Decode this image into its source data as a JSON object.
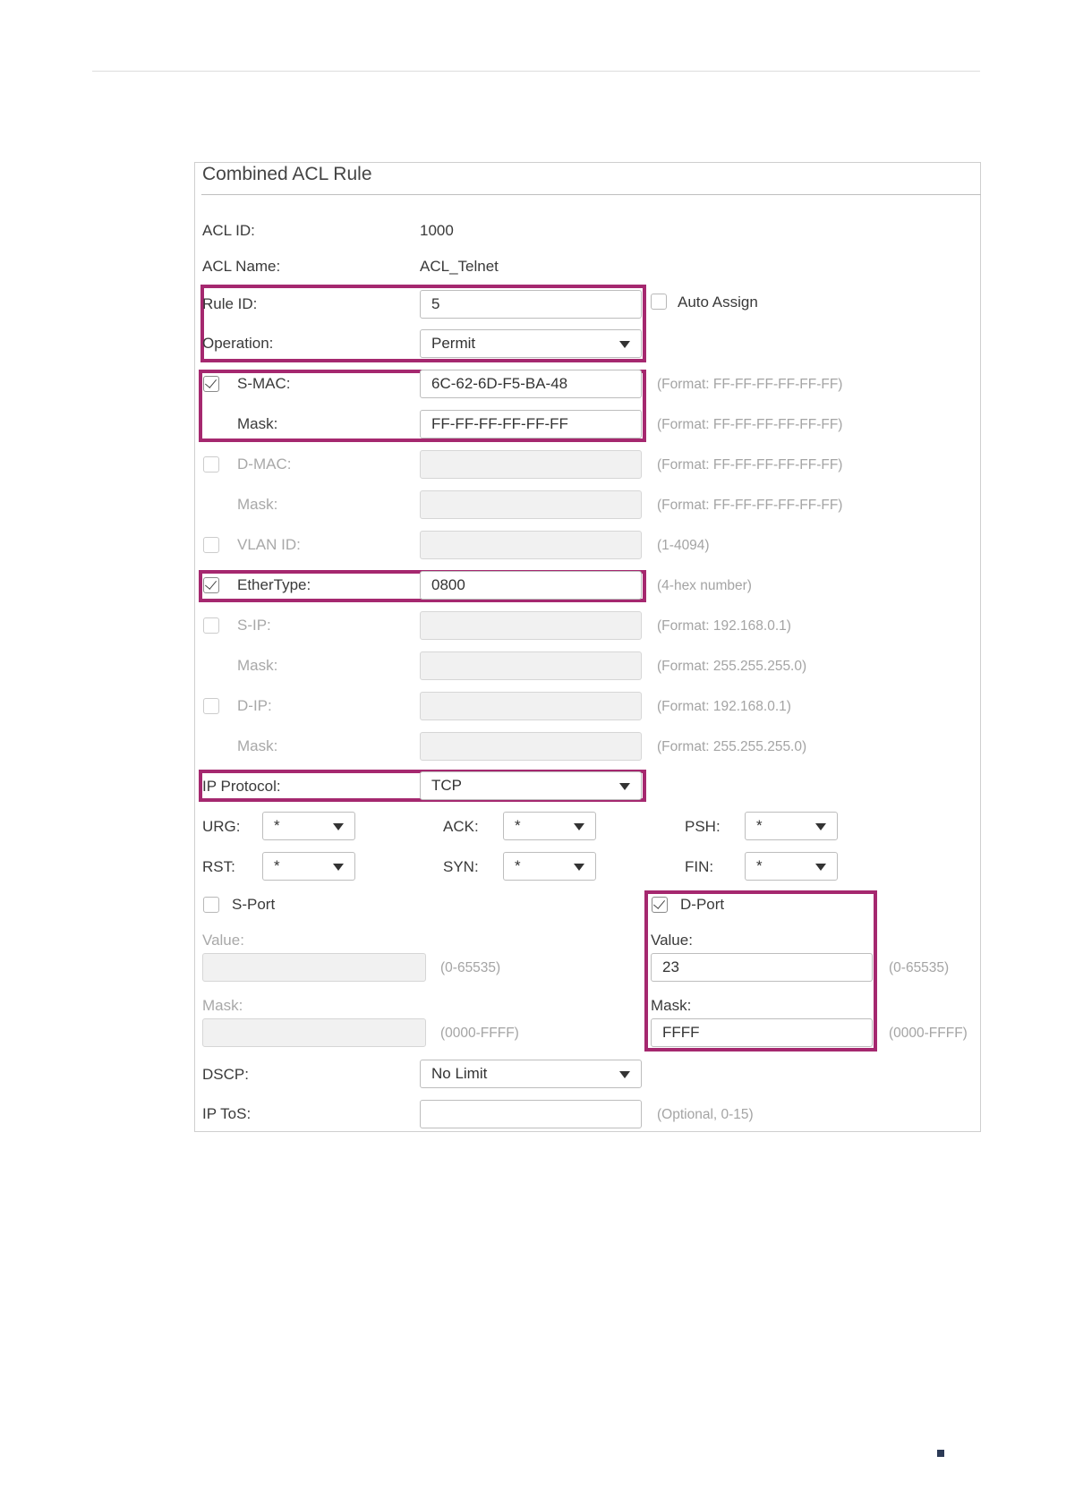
{
  "panel": {
    "title": "Combined ACL Rule"
  },
  "acl_id": {
    "label": "ACL ID:",
    "value": "1000"
  },
  "acl_name": {
    "label": "ACL Name:",
    "value": "ACL_Telnet"
  },
  "rule_id": {
    "label": "Rule ID:",
    "value": "5",
    "auto_assign_label": "Auto Assign",
    "auto_assign_checked": false
  },
  "operation": {
    "label": "Operation:",
    "value": "Permit"
  },
  "s_mac": {
    "label": "S-MAC:",
    "checked": true,
    "value": "6C-62-6D-F5-BA-48",
    "hint": "(Format: FF-FF-FF-FF-FF-FF)",
    "mask_label": "Mask:",
    "mask_value": "FF-FF-FF-FF-FF-FF",
    "mask_hint": "(Format: FF-FF-FF-FF-FF-FF)"
  },
  "d_mac": {
    "label": "D-MAC:",
    "checked": false,
    "value": "",
    "hint": "(Format: FF-FF-FF-FF-FF-FF)",
    "mask_label": "Mask:",
    "mask_value": "",
    "mask_hint": "(Format: FF-FF-FF-FF-FF-FF)"
  },
  "vlan_id": {
    "label": "VLAN ID:",
    "checked": false,
    "value": "",
    "hint": "(1-4094)"
  },
  "ethertype": {
    "label": "EtherType:",
    "checked": true,
    "value": "0800",
    "hint": "(4-hex number)"
  },
  "s_ip": {
    "label": "S-IP:",
    "checked": false,
    "value": "",
    "hint": "(Format: 192.168.0.1)",
    "mask_label": "Mask:",
    "mask_value": "",
    "mask_hint": "(Format: 255.255.255.0)"
  },
  "d_ip": {
    "label": "D-IP:",
    "checked": false,
    "value": "",
    "hint": "(Format: 192.168.0.1)",
    "mask_label": "Mask:",
    "mask_value": "",
    "mask_hint": "(Format: 255.255.255.0)"
  },
  "ip_protocol": {
    "label": "IP Protocol:",
    "value": "TCP"
  },
  "flags": {
    "urg": {
      "label": "URG:",
      "value": "*"
    },
    "ack": {
      "label": "ACK:",
      "value": "*"
    },
    "psh": {
      "label": "PSH:",
      "value": "*"
    },
    "rst": {
      "label": "RST:",
      "value": "*"
    },
    "syn": {
      "label": "SYN:",
      "value": "*"
    },
    "fin": {
      "label": "FIN:",
      "value": "*"
    }
  },
  "s_port": {
    "label": "S-Port",
    "checked": false,
    "value_label": "Value:",
    "value": "",
    "value_hint": "(0-65535)",
    "mask_label": "Mask:",
    "mask_value": "",
    "mask_hint": "(0000-FFFF)"
  },
  "d_port": {
    "label": "D-Port",
    "checked": true,
    "value_label": "Value:",
    "value": "23",
    "value_hint": "(0-65535)",
    "mask_label": "Mask:",
    "mask_value": "FFFF",
    "mask_hint": "(0000-FFFF)"
  },
  "dscp": {
    "label": "DSCP:",
    "value": "No Limit"
  },
  "ip_tos": {
    "label": "IP ToS:",
    "value": "",
    "hint": "(Optional, 0-15)"
  },
  "colors": {
    "highlight": "#a5286f",
    "page_marker": "#2c3a56"
  }
}
